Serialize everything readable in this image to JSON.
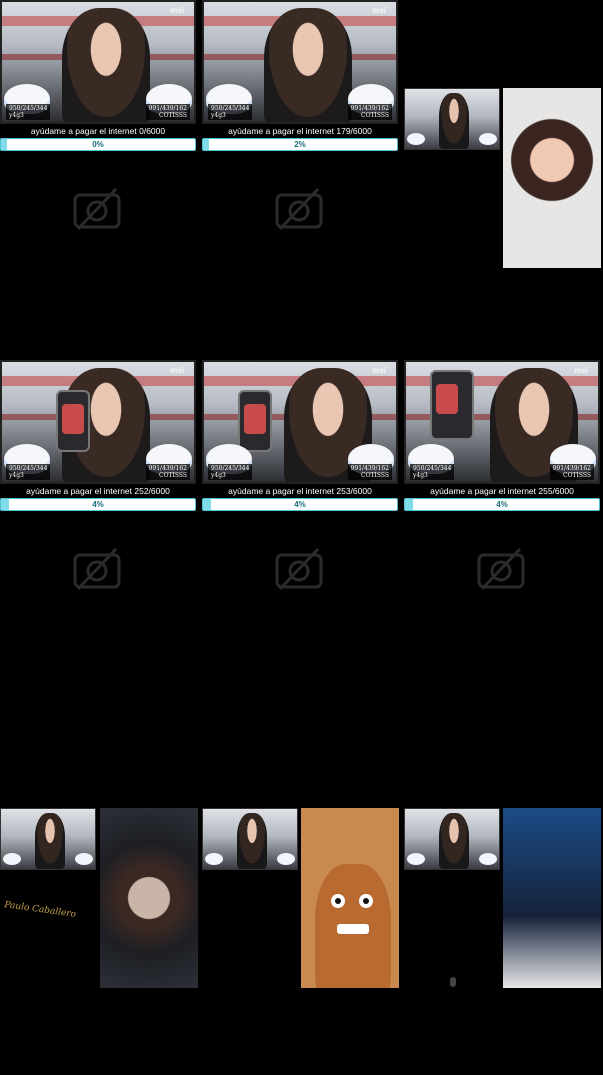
{
  "grid": {
    "tiles": [
      {
        "goal": "ayúdame a pagar el internet  0/6000",
        "percent": "0%",
        "fill": 0,
        "tag_left": "950/245/344\ny4g3",
        "tag_right": "991/439/162\nCOTISSS",
        "brand": "msi",
        "phone": false
      },
      {
        "goal": "ayúdame a pagar el internet  179/6000",
        "percent": "2%",
        "fill": 0.02,
        "tag_left": "950/245/344\ny4g3",
        "tag_right": "991/439/162\nCOTISSS",
        "brand": "msi",
        "phone": false
      },
      {
        "goal": "ayúdame a pagar el internet  252/6000",
        "percent": "4%",
        "fill": 0.04,
        "tag_left": "950/245/344\ny4g3",
        "tag_right": "991/439/162\nCOTISSS",
        "brand": "msi",
        "phone": true
      },
      {
        "goal": "ayúdame a pagar el internet  253/6000",
        "percent": "4%",
        "fill": 0.04,
        "tag_left": "950/245/344\ny4g3",
        "tag_right": "991/439/162\nCOTISSS",
        "brand": "msi",
        "phone": true
      },
      {
        "goal": "ayúdame a pagar el internet  255/6000",
        "percent": "4%",
        "fill": 0.04,
        "tag_left": "950/245/344\ny4g3",
        "tag_right": "991/439/162\nCOTISSS",
        "brand": "msi",
        "phone": true
      }
    ],
    "camera_off_icon": "camera-off-icon"
  },
  "signature": "Paulo Caballero",
  "colors": {
    "progress_fill": "#7fdce8",
    "progress_border": "#4cc4d6",
    "background": "#000000"
  }
}
